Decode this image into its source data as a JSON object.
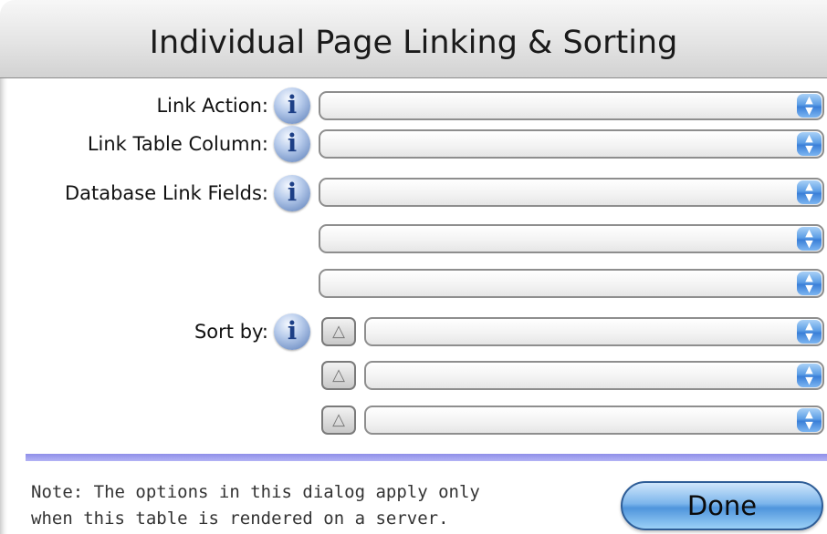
{
  "window": {
    "title": "Individual Page Linking & Sorting"
  },
  "rows": {
    "link_action": {
      "label": "Link Action:",
      "value": ""
    },
    "link_table_column": {
      "label": "Link Table Column:",
      "value": ""
    },
    "database_link_fields": {
      "label": "Database Link Fields:",
      "values": [
        "",
        "",
        ""
      ]
    },
    "sort_by": {
      "label": "Sort by:",
      "direction_symbol": "△",
      "values": [
        "",
        "",
        ""
      ]
    }
  },
  "info_symbol": "i",
  "popup_arrows": {
    "up": "▲",
    "down": "▼"
  },
  "footer": {
    "note_line1": "Note: The options in this dialog apply only",
    "note_line2": "when this table is rendered on a server.",
    "done_label": "Done"
  },
  "colors": {
    "accent": "#5e9fe6",
    "divider": "#a0a0ee"
  },
  "icons": {
    "info": "info-icon",
    "popup": "popup-arrows-icon",
    "sort": "sort-direction-icon"
  }
}
